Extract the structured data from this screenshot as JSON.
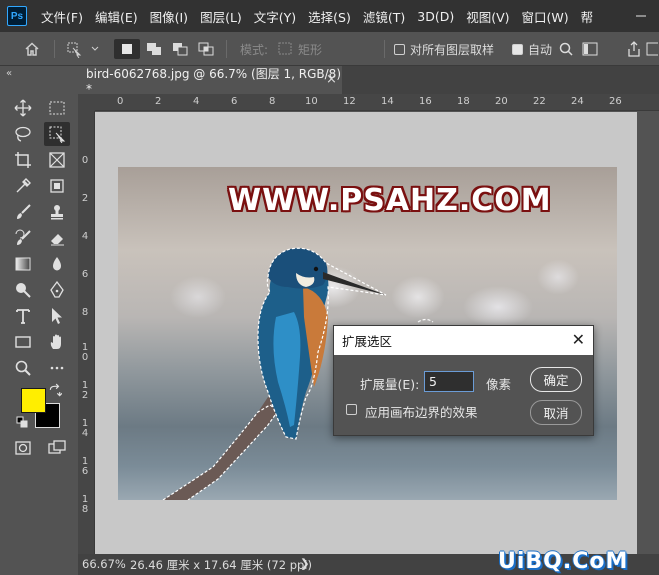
{
  "app": {
    "logo_text": "Ps"
  },
  "menu": [
    "文件(F)",
    "编辑(E)",
    "图像(I)",
    "图层(L)",
    "文字(Y)",
    "选择(S)",
    "滤镜(T)",
    "3D(D)",
    "视图(V)",
    "窗口(W)",
    "帮"
  ],
  "options_bar": {
    "mode_label": "模式:",
    "mode_value": "矩形",
    "sample_all_layers": "对所有图层取样",
    "auto_label": "自动"
  },
  "document": {
    "tab_title": "bird-6062768.jpg @ 66.7% (图层 1, RGB/8) *",
    "tab_close": "×"
  },
  "rulers": {
    "top": [
      "0",
      "2",
      "4",
      "6",
      "8",
      "10",
      "12",
      "14",
      "16",
      "18",
      "20",
      "22",
      "24",
      "26"
    ],
    "left": [
      "0",
      "2",
      "4",
      "6",
      "8",
      "1\n0",
      "1\n2",
      "1\n4",
      "1\n6",
      "1\n8"
    ]
  },
  "watermark": "WWW.PSAHZ.COM",
  "dialog": {
    "title": "扩展选区",
    "close": "✕",
    "expand_label": "扩展量(E):",
    "expand_value": "5",
    "unit": "像素",
    "ok": "确定",
    "cancel": "取消",
    "apply_canvas_bounds": "应用画布边界的效果",
    "apply_checked": false
  },
  "colors": {
    "foreground": "#ffee00",
    "background": "#000000",
    "accent": "#31a8ff"
  },
  "statusbar": {
    "zoom": "66.67%",
    "doc_info": "26.46 厘米 x 17.64 厘米 (72 ppi)",
    "arrow": "❯"
  },
  "site_logo": "UiBQ.CoM"
}
